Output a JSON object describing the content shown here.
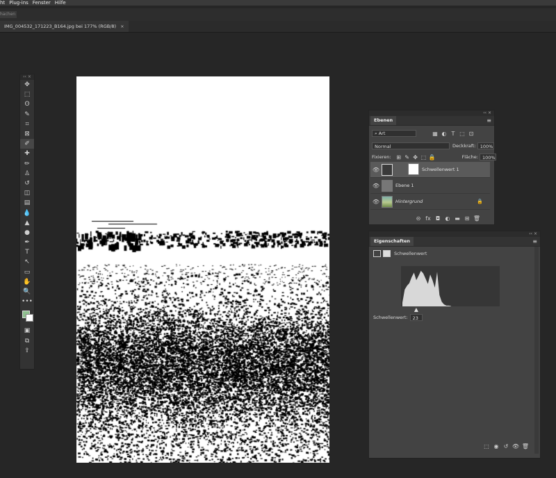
{
  "menu": {
    "items": [
      "ht",
      "Plug-ins",
      "Fenster",
      "Hilfe"
    ]
  },
  "options_bar": {
    "ghost_label": "hachen"
  },
  "document": {
    "tab_title": "IMG_004532_171223_B164.jpg bei 177% (RGB/8)",
    "close_glyph": "×"
  },
  "toolbar": {
    "collapse": "‹‹ ×",
    "tools": [
      {
        "name": "move-tool",
        "glyph": "✥"
      },
      {
        "name": "marquee-tool",
        "glyph": "⬚"
      },
      {
        "name": "lasso-tool",
        "glyph": "ʘ"
      },
      {
        "name": "quick-select-tool",
        "glyph": "✎"
      },
      {
        "name": "crop-tool",
        "glyph": "⌗"
      },
      {
        "name": "frame-tool",
        "glyph": "⊠"
      },
      {
        "name": "eyedropper-tool",
        "glyph": "✐"
      },
      {
        "name": "healing-brush-tool",
        "glyph": "✚"
      },
      {
        "name": "brush-tool",
        "glyph": "✏"
      },
      {
        "name": "clone-stamp-tool",
        "glyph": "♙"
      },
      {
        "name": "history-brush-tool",
        "glyph": "↺"
      },
      {
        "name": "eraser-tool",
        "glyph": "◫"
      },
      {
        "name": "gradient-tool",
        "glyph": "▤"
      },
      {
        "name": "blur-tool",
        "glyph": "💧"
      },
      {
        "name": "sharpen-tool",
        "glyph": "▲"
      },
      {
        "name": "dodge-tool",
        "glyph": "●"
      },
      {
        "name": "pen-tool",
        "glyph": "✒"
      },
      {
        "name": "type-tool",
        "glyph": "T"
      },
      {
        "name": "path-select-tool",
        "glyph": "↖"
      },
      {
        "name": "rectangle-tool",
        "glyph": "▭"
      },
      {
        "name": "hand-tool",
        "glyph": "✋"
      },
      {
        "name": "zoom-tool",
        "glyph": "🔍"
      },
      {
        "name": "more-tools",
        "glyph": "•••"
      }
    ],
    "extra": [
      {
        "name": "quick-mask-icon",
        "glyph": "▣"
      },
      {
        "name": "screen-mode-icon",
        "glyph": "⧉"
      },
      {
        "name": "share-icon",
        "glyph": "⇪"
      }
    ],
    "active_index": 6
  },
  "layers_panel": {
    "collapse": "‹‹ ×",
    "tab_label": "Ebenen",
    "menu_glyph": "≡",
    "filter": {
      "search_glyph": "⌕",
      "value": "Art",
      "icons": [
        "▦",
        "◐",
        "T",
        "⬚",
        "⊡"
      ]
    },
    "blend_mode": "Normal",
    "opacity_label": "Deckkraft:",
    "opacity_value": "100%",
    "lock_label": "Fixieren:",
    "lock_icons": [
      "⊞",
      "✎",
      "✥",
      "⬚",
      "🔒"
    ],
    "fill_label": "Fläche:",
    "fill_value": "100%",
    "layers": [
      {
        "name": "Schwellenwert 1",
        "selected": true,
        "italic": false,
        "locked": false
      },
      {
        "name": "Ebene 1",
        "selected": false,
        "italic": false,
        "locked": false
      },
      {
        "name": "Hintergrund",
        "selected": false,
        "italic": true,
        "locked": true
      }
    ],
    "lock_glyph": "🔒",
    "footer_icons": [
      "⊝",
      "fx",
      "◘",
      "◐",
      "▬",
      "⊞",
      "🗑"
    ]
  },
  "properties_panel": {
    "collapse": "‹‹ ×",
    "tab_label": "Eigenschaften",
    "menu_glyph": "≡",
    "adjustment_title": "Schwellenwert",
    "threshold_label": "Schwellenwert:",
    "threshold_value": "23",
    "histogram_max_level": 255,
    "histogram_slider_level": 23,
    "footer_icons": [
      "⬚",
      "◉",
      "↺",
      "👁",
      "🗑"
    ]
  },
  "colors": {
    "foreground": "#8fbf8f",
    "background": "#ffffff"
  }
}
